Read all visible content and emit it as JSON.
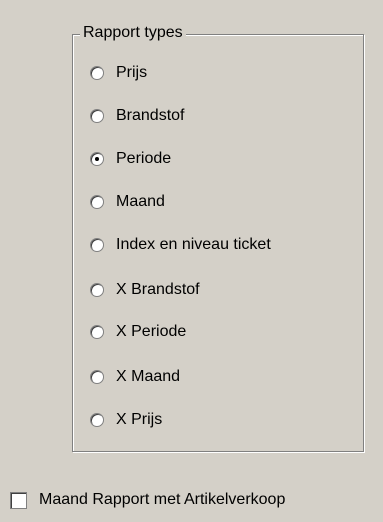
{
  "group": {
    "title": "Rapport types"
  },
  "radios": [
    {
      "label": "Prijs",
      "checked": false
    },
    {
      "label": "Brandstof",
      "checked": false
    },
    {
      "label": "Periode",
      "checked": true
    },
    {
      "label": "Maand",
      "checked": false
    },
    {
      "label": "Index en niveau ticket",
      "checked": false
    },
    {
      "label": "X Brandstof",
      "checked": false
    },
    {
      "label": "X Periode",
      "checked": false
    },
    {
      "label": "X Maand",
      "checked": false
    },
    {
      "label": "X Prijs",
      "checked": false
    }
  ],
  "checkbox": {
    "label": "Maand Rapport met Artikelverkoop",
    "checked": false
  },
  "colors": {
    "window_background": "#d4d0c8",
    "border_shadow": "#808080",
    "border_highlight": "#ffffff"
  }
}
